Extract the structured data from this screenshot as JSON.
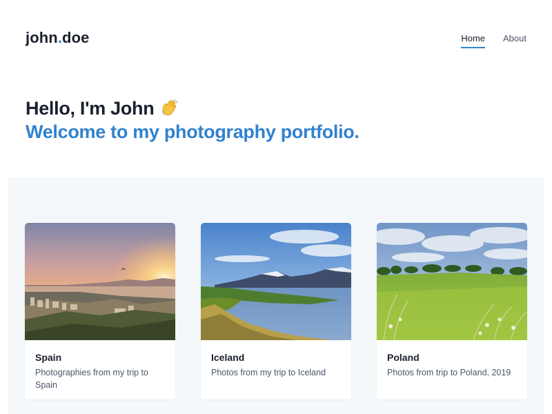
{
  "header": {
    "logo_first": "john",
    "logo_dot": ".",
    "logo_last": "doe",
    "nav": [
      {
        "label": "Home",
        "active": true
      },
      {
        "label": "About",
        "active": false
      }
    ]
  },
  "hero": {
    "greeting": "Hello, I'm John",
    "greeting_icon": "waving-hand-icon",
    "tagline": "Welcome to my photography portfolio."
  },
  "colors": {
    "accent": "#3182ce",
    "text": "#1a202c",
    "muted": "#4a5568",
    "section_bg": "#f5f8fb"
  },
  "gallery": {
    "cards": [
      {
        "title": "Spain",
        "description": "Photographies from my trip to Spain",
        "image": "spain-coastal-city-sunset-photo"
      },
      {
        "title": "Iceland",
        "description": "Photos from my trip to Iceland",
        "image": "iceland-fjord-mountains-photo"
      },
      {
        "title": "Poland",
        "description": "Photos from trip to Poland, 2019",
        "image": "poland-green-meadow-photo"
      }
    ]
  }
}
